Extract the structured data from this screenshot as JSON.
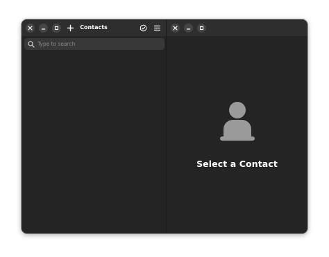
{
  "window": {
    "title": "Contacts"
  },
  "search": {
    "placeholder": "Type to search",
    "value": ""
  },
  "icons": {
    "close": "close-icon",
    "minimize": "minimize-icon",
    "maximize": "maximize-icon",
    "add": "plus-icon",
    "select": "check-circle-icon",
    "menu": "hamburger-menu-icon",
    "search": "search-icon",
    "placeholder_avatar": "person-icon"
  },
  "detail": {
    "empty_state_label": "Select a Contact"
  },
  "colors": {
    "window_bg": "#242424",
    "header_bg": "#2e2e2e",
    "button_bg": "#454545",
    "search_bg": "#383838",
    "avatar_placeholder": "#9a9a9a",
    "text": "#ffffff"
  }
}
